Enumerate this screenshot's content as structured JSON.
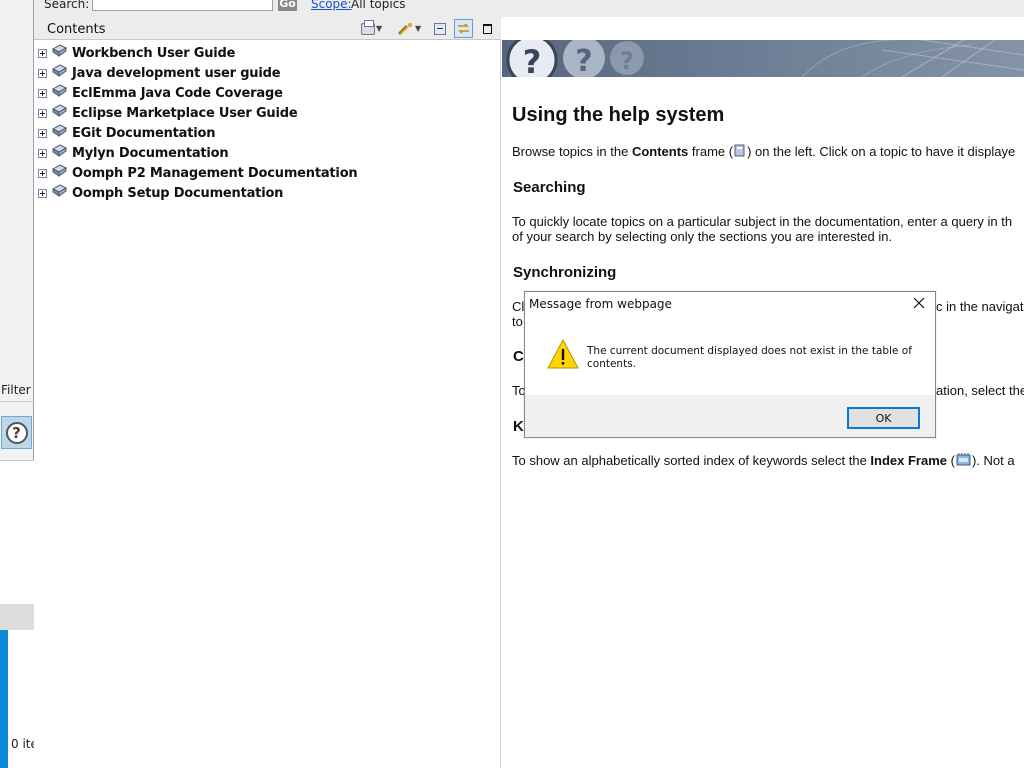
{
  "search_bar": {
    "label": "Search:",
    "input_value": "",
    "go_label": "Go",
    "scope_link": "Scope:",
    "scope_value": "All topics"
  },
  "left_strip": {
    "filter_label": "Filter r",
    "items_label": "0 ite"
  },
  "contents": {
    "title": "Contents",
    "items": [
      {
        "label": "Workbench User Guide"
      },
      {
        "label": "Java development user guide"
      },
      {
        "label": "EclEmma Java Code Coverage"
      },
      {
        "label": "Eclipse Marketplace User Guide"
      },
      {
        "label": "EGit Documentation"
      },
      {
        "label": "Mylyn Documentation"
      },
      {
        "label": "Oomph P2 Management Documentation"
      },
      {
        "label": "Oomph Setup Documentation"
      }
    ]
  },
  "content": {
    "heading": "Using the help system",
    "browse": {
      "before": "Browse topics in the ",
      "bold": "Contents",
      "after_bold": " frame (",
      "after_icon": ") on the left. Click on a topic to have it displaye"
    },
    "searching_heading": "Searching",
    "searching_line1": "To quickly locate topics on a particular subject in the documentation, enter a query in th",
    "searching_line2": "of your search by selecting only the sections you are interested in.",
    "synchronizing_heading": "Synchronizing",
    "sync_line1_left": "Cl",
    "sync_line1_right": "c in the navigati",
    "sync_line2_left": "to",
    "categories_heading_left": "Ca",
    "categories_line_left": "To",
    "categories_line_right": "ation, select the",
    "keywords_heading_left": "Ke",
    "index": {
      "before": "To show an alphabetically sorted index of keywords select the ",
      "bold": "Index Frame",
      "after_bold": " (",
      "after_icon": "). Not a"
    }
  },
  "dialog": {
    "title": "Message from webpage",
    "message": "The current document displayed does not exist in the table of contents.",
    "ok_label": "OK"
  }
}
